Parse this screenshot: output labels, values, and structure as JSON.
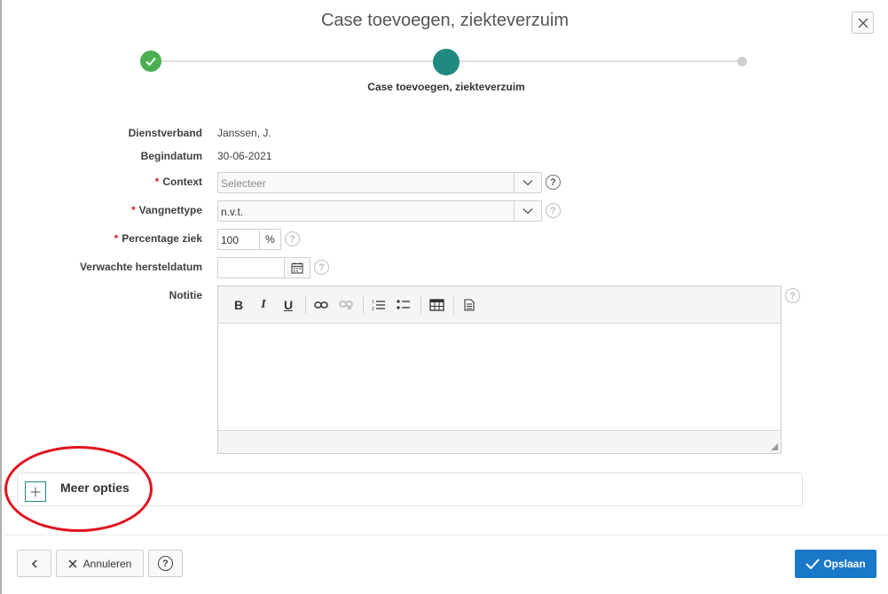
{
  "dialog": {
    "title": "Case toevoegen, ziekteverzuim",
    "close_icon": "close-icon"
  },
  "stepper": {
    "current_label": "Case toevoegen, ziekteverzuim",
    "colors": {
      "done": "#4caf50",
      "current": "#1f8a80",
      "pending": "#cfcfcf"
    }
  },
  "form": {
    "dienstverband": {
      "label": "Dienstverband",
      "value": "Janssen, J."
    },
    "begindatum": {
      "label": "Begindatum",
      "value": "30-06-2021"
    },
    "context": {
      "label": "Context",
      "required": "*",
      "placeholder": "Selecteer"
    },
    "vangnettype": {
      "label": "Vangnettype",
      "required": "*",
      "value": "n.v.t."
    },
    "percentage": {
      "label": "Percentage ziek",
      "required": "*",
      "value": "100",
      "unit": "%"
    },
    "hersteldatum": {
      "label": "Verwachte hersteldatum",
      "value": ""
    },
    "notitie": {
      "label": "Notitie"
    },
    "help_glyph": "?"
  },
  "editor": {
    "toolbar": [
      {
        "name": "bold-icon",
        "glyph": "B"
      },
      {
        "name": "italic-icon",
        "glyph": "I"
      },
      {
        "name": "underline-icon",
        "glyph": "U"
      }
    ]
  },
  "more": {
    "label": "Meer opties"
  },
  "footer": {
    "cancel_label": "Annuleren",
    "save_label": "Opslaan",
    "help_glyph": "?"
  },
  "colors": {
    "accent": "#1f8a80",
    "primary_button": "#1a78c8",
    "required": "#d9232d",
    "annotation": "#e0141e"
  }
}
